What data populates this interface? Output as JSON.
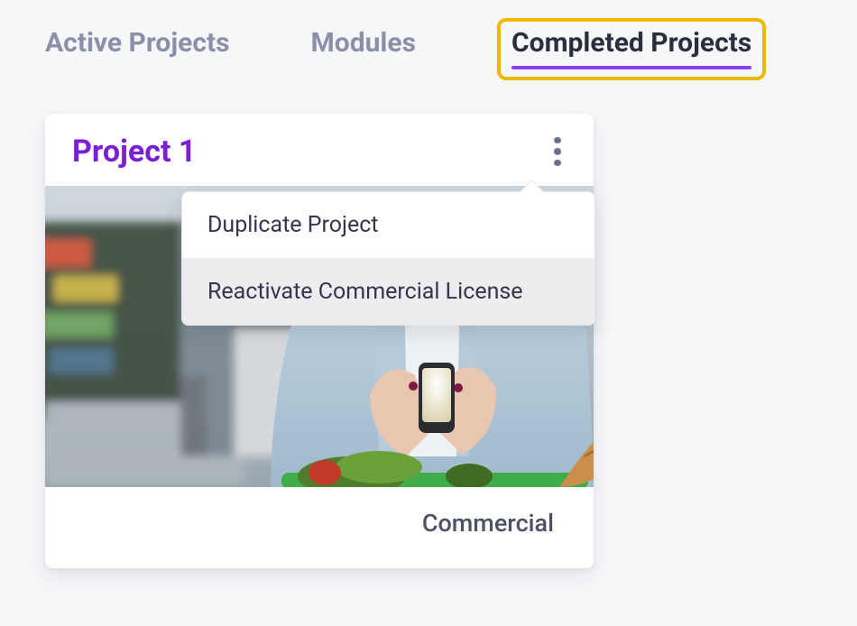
{
  "tabs": {
    "active_projects": "Active Projects",
    "modules": "Modules",
    "completed_projects": "Completed Projects"
  },
  "card": {
    "title": "Project 1",
    "footer_label": "Commercial"
  },
  "menu": {
    "duplicate": "Duplicate Project",
    "reactivate": "Reactivate Commercial License"
  }
}
